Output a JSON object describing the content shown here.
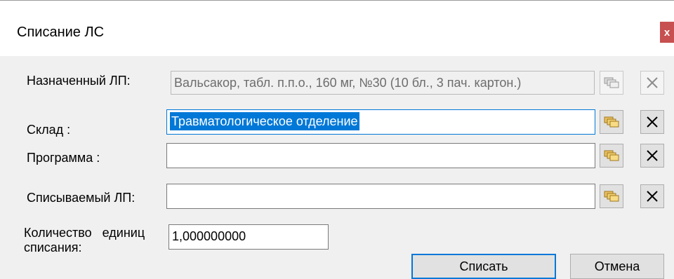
{
  "dialog": {
    "title": "Списание ЛС",
    "close_label": "x"
  },
  "form": {
    "assigned_drug": {
      "label": "Назначенный ЛП:",
      "value": "Вальсакор, табл. п.п.о., 160 мг, №30 (10 бл., 3 пач. картон.)",
      "enabled": false
    },
    "warehouse": {
      "label": "Склад :",
      "value": "Травматологическое отделение",
      "selected": true
    },
    "program": {
      "label": "Программа :",
      "value": ""
    },
    "writeoff_drug": {
      "label": "Списываемый ЛП:",
      "value": ""
    },
    "quantity": {
      "label_line1": "Количество   единиц",
      "label_line2": "списания:",
      "value": "1,000000000"
    }
  },
  "buttons": {
    "submit_label": "Списать",
    "cancel_label": "Отмена"
  },
  "icons": {
    "lookup": "folders-icon",
    "clear": "x-icon"
  },
  "colors": {
    "selection": "#0078d7",
    "close_button": "#c75050"
  }
}
